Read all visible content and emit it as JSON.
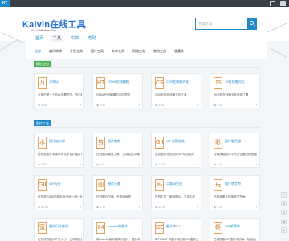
{
  "topbar": {
    "logo_text": "KT",
    "brand_color": "#1e88c8"
  },
  "header": {
    "brand": "Kalvin在线工具",
    "subtitle": "一个有温度的工具箱",
    "search_placeholder": "搜索工具",
    "quick_links": [
      "首页",
      "关于",
      "留言",
      "捐赠",
      "API"
    ]
  },
  "main_tabs": [
    "首页",
    "工具",
    "文档",
    "帮助"
  ],
  "sub_tabs": [
    "全部",
    "编码转换",
    "开发工具",
    "图片工具",
    "文本工具",
    "网络工具",
    "其他工具",
    "收藏夹"
  ],
  "sections": [
    {
      "title": "最近使用",
      "color": "#4caf50",
      "cards": [
        {
          "icon": "万",
          "name": "万年历",
          "desc": "万年历是一个可以查看农历、节日和节气的工具",
          "views": "2.5k"
        },
        {
          "icon": "HT",
          "name": "HTML在线编辑",
          "desc": "HTML在线编辑与实时预览",
          "views": "5.9k"
        },
        {
          "icon": "CS",
          "name": "CSS在线格式化",
          "desc": "CSS代码在线格式化工具",
          "views": "3.3k"
        },
        {
          "icon": "JS",
          "name": "JS在线格式化",
          "desc": "JS代码在线格式化压缩工具",
          "views": "3.4k"
        }
      ]
    },
    {
      "title": "图片工具",
      "color": "#1e88c8",
      "cards": [
        {
          "icon": "水",
          "name": "图片加水印",
          "desc": "在线给图片添加水印文字保护图片版权信息",
          "views": "2.3k"
        },
        {
          "icon": "剪",
          "name": "图片裁剪",
          "desc": "在线图片裁剪工具，支持自定义裁剪尺寸",
          "views": "5.0k"
        },
        {
          "icon": "GIF",
          "name": "GIF动图合成",
          "desc": "多张图片在线合成GIF动态图片",
          "views": "12.9k"
        },
        {
          "icon": "彩",
          "name": "图片取色器",
          "desc": "在线获取图片中任意位置的颜色值",
          "views": "4.9k"
        },
        {
          "icon": "GIF",
          "name": "GIF拆分",
          "desc": "在线将GIF动态图片拆分成一帧一帧的图片",
          "views": "41.5k"
        },
        {
          "icon": "图",
          "name": "图片压缩",
          "desc": "在线图片压缩，不影响画质",
          "views": "9.1k"
        },
        {
          "icon": "码",
          "name": "二维码生成",
          "desc": "在线生成二维码图片，支持中文",
          "views": "32.5k"
        },
        {
          "icon": "玩",
          "name": "图片转字符",
          "desc": "在线将图片转换成字符画",
          "views": "3.5k"
        },
        {
          "icon": "宽",
          "name": "图片尺寸修改",
          "desc": "在线修改图片尺寸大小，支持等比缩放",
          "views": "23.0k"
        },
        {
          "icon": "64",
          "name": "base64转图片",
          "desc": "将base64编码转换为图片，图片转base64编码",
          "views": "23.5k"
        },
        {
          "icon": "I2C",
          "name": "图片转ICO",
          "desc": "将PNG/JPG图片转换成ICO图标文件",
          "views": "4.6k"
        },
        {
          "icon": "帧",
          "name": "GIF帧提取",
          "desc": "在线提取GIF图片中的每一帧画面",
          "views": "4.3k"
        }
      ]
    }
  ],
  "floating_buttons": [
    "↑",
    "◎",
    "✎",
    "⊕",
    "▲"
  ]
}
